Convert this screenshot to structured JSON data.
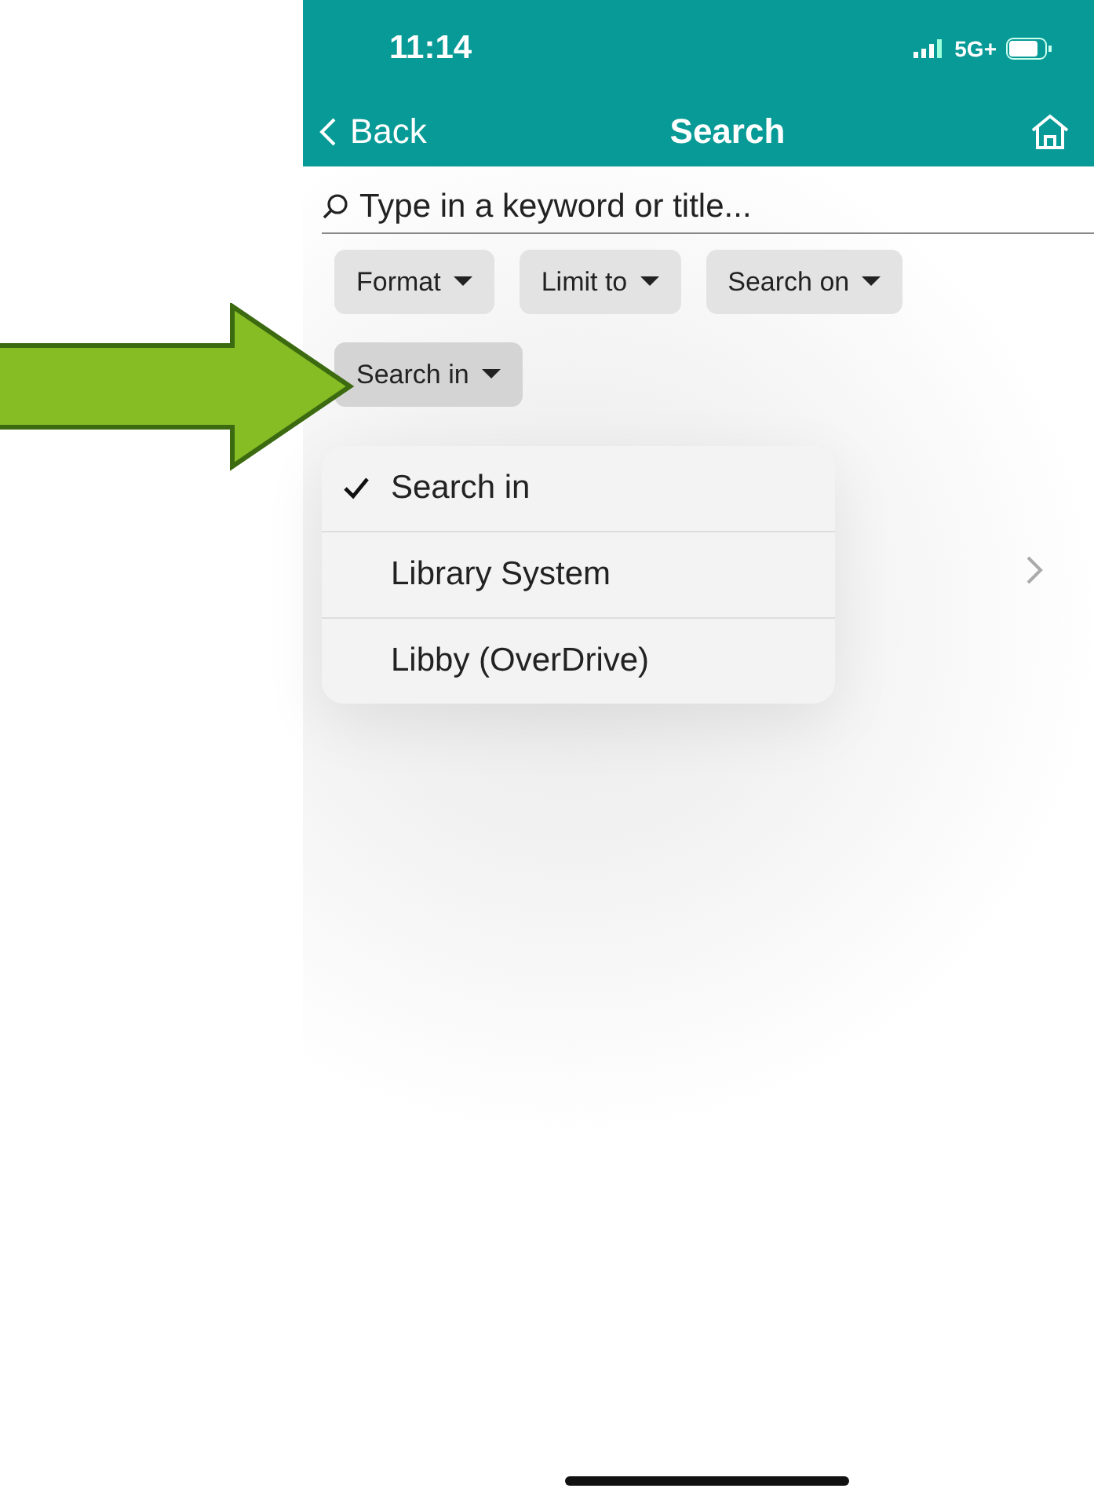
{
  "status_bar": {
    "time": "11:14",
    "network": "5G+"
  },
  "nav": {
    "back": "Back",
    "title": "Search"
  },
  "search": {
    "placeholder": "Type in a keyword or title..."
  },
  "filters": [
    {
      "label": "Format",
      "selected": false
    },
    {
      "label": "Limit to",
      "selected": false
    },
    {
      "label": "Search on",
      "selected": false
    },
    {
      "label": "Search in",
      "selected": true
    }
  ],
  "menu": [
    {
      "label": "Search in",
      "checked": true
    },
    {
      "label": "Library System",
      "checked": false
    },
    {
      "label": "Libby (OverDrive)",
      "checked": false
    }
  ]
}
